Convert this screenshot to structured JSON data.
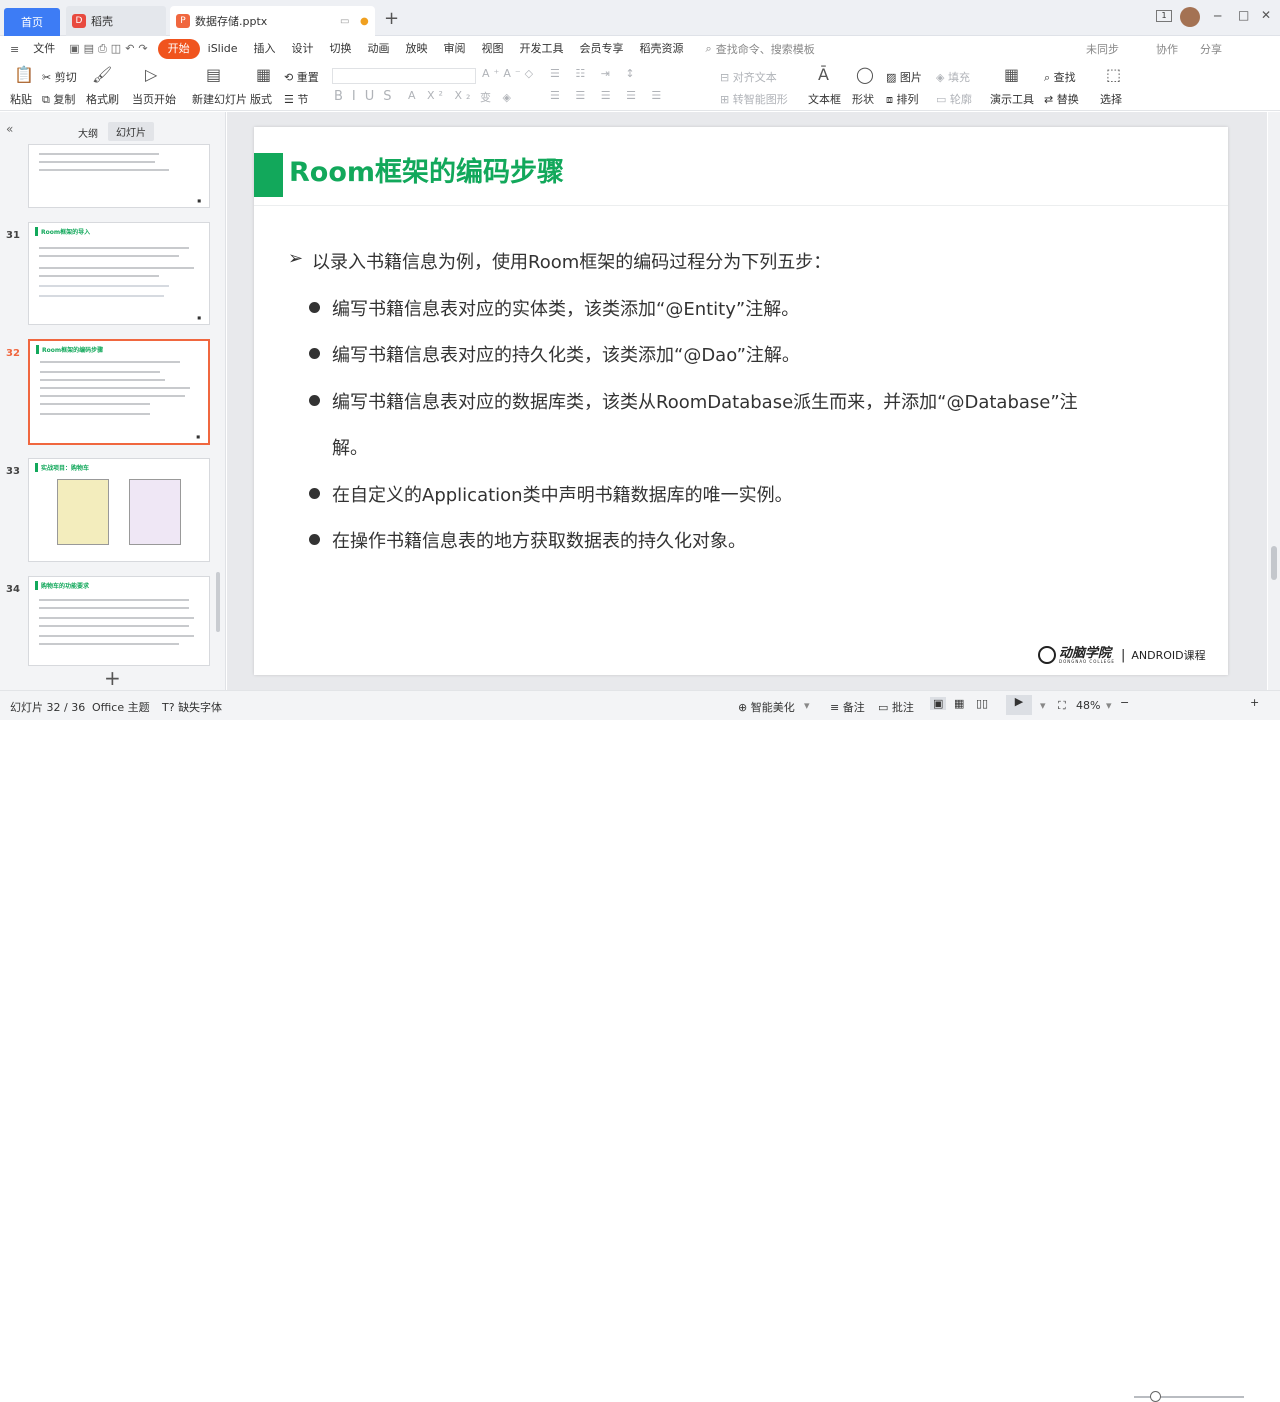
{
  "tabs": {
    "home": "首页",
    "docer": "稻壳",
    "file": "数据存储.pptx"
  },
  "window": {
    "badge": "1"
  },
  "menu": {
    "items": [
      "文件",
      "开始",
      "iSlide",
      "插入",
      "设计",
      "切换",
      "动画",
      "放映",
      "审阅",
      "视图",
      "开发工具",
      "会员专享",
      "稻壳资源"
    ],
    "search": "查找命令、搜索模板",
    "share_a": "未同步",
    "share_b": "协作",
    "share_c": "分享"
  },
  "ribbon": {
    "paste": "粘贴",
    "cut": "剪切",
    "copy": "复制",
    "format": "格式刷",
    "start": "当页开始",
    "new_slide": "新建幻灯片",
    "layout": "版式",
    "section": "节",
    "reset": "重置",
    "align_text": "对齐文本",
    "smart": "转智能图形",
    "textbox": "文本框",
    "shape": "形状",
    "picture": "图片",
    "arrange": "排列",
    "fill": "填充",
    "outline": "轮廓",
    "present": "演示工具",
    "find": "查找",
    "replace": "替换",
    "select": "选择"
  },
  "panel": {
    "outline": "大纲",
    "slides": "幻灯片",
    "add": "+"
  },
  "thumbs": [
    {
      "num": "31",
      "title": "Room框架的导入"
    },
    {
      "num": "32",
      "title": "Room框架的编码步骤"
    },
    {
      "num": "33",
      "title": "实战项目：购物车"
    },
    {
      "num": "34",
      "title": "购物车的功能要求"
    }
  ],
  "slide": {
    "title": "Room框架的编码步骤",
    "intro": "以录入书籍信息为例，使用Room框架的编码过程分为下列五步：",
    "bullets": [
      "编写书籍信息表对应的实体类，该类添加“@Entity”注解。",
      "编写书籍信息表对应的持久化类，该类添加“@Dao”注解。",
      "编写书籍信息表对应的数据库类，该类从RoomDatabase派生而来，并添加“@Database”注",
      "在自定义的Application类中声明书籍数据库的唯一实例。",
      "在操作书籍信息表的地方获取数据表的持久化对象。"
    ],
    "wrap": "解。",
    "logo_name": "动脑学院",
    "logo_sub": "DONGNAO COLLEGE",
    "logo_course": "ANDROID课程"
  },
  "status": {
    "slide_pos": "幻灯片 32 / 36",
    "theme": "Office 主题",
    "font_missing": "缺失字体",
    "beautify": "智能美化",
    "notes": "备注",
    "comment": "批注",
    "zoom": "48%"
  }
}
